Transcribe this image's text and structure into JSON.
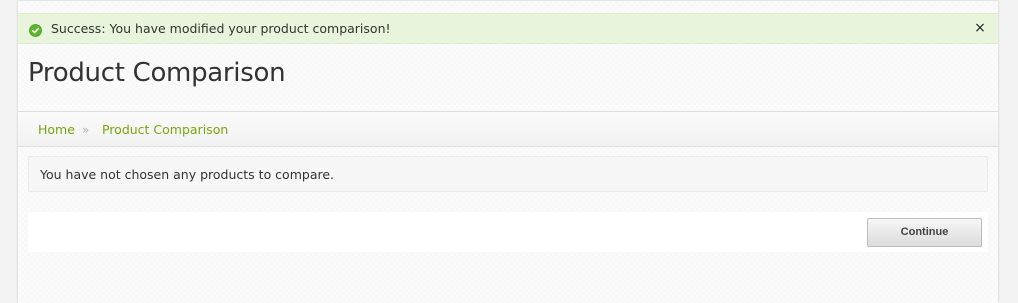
{
  "alert": {
    "message": "Success: You have modified your product comparison!",
    "close_symbol": "×",
    "icon": "check-circle-icon",
    "color": "#5cb82a"
  },
  "page": {
    "title": "Product Comparison"
  },
  "breadcrumb": {
    "items": [
      {
        "label": "Home"
      },
      {
        "label": "Product Comparison"
      }
    ],
    "separator": "»",
    "link_color": "#76a70d"
  },
  "content": {
    "empty_message": "You have not chosen any products to compare."
  },
  "actions": {
    "continue_label": "Continue"
  }
}
